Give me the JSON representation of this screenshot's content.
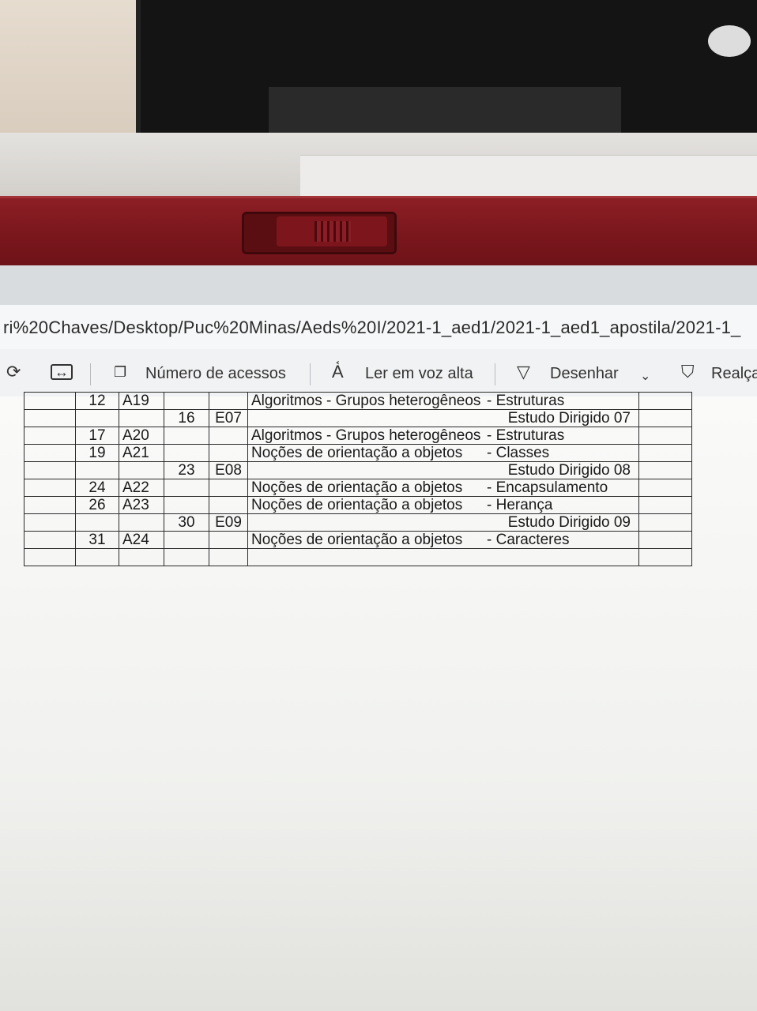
{
  "address_bar": {
    "url_text": "ri%20Chaves/Desktop/Puc%20Minas/Aeds%20I/2021-1_aed1/2021-1_aed1_apostila/2021-1_"
  },
  "toolbar": {
    "items": [
      {
        "name": "rotate",
        "icon": "rotate-icon"
      },
      {
        "name": "fit",
        "icon": "fit-width-icon"
      },
      {
        "name": "page_view",
        "label": "Número de acessos",
        "icon": "page-view-icon"
      },
      {
        "name": "read_aloud",
        "label": "Ler em voz alta",
        "icon": "read-aloud-icon"
      },
      {
        "name": "draw",
        "label": "Desenhar",
        "icon": "draw-icon"
      },
      {
        "name": "highlight",
        "label": "Realça",
        "icon": "highlight-icon"
      }
    ]
  },
  "table": {
    "rows": [
      {
        "day": "12",
        "code": "A19",
        "day2": "",
        "code2": "",
        "topic": "Algoritmos - Grupos heterogêneos",
        "sub": "- Estruturas",
        "study": ""
      },
      {
        "day": "",
        "code": "",
        "day2": "16",
        "code2": "E07",
        "topic": "",
        "sub": "",
        "study": "Estudo Dirigido 07"
      },
      {
        "day": "17",
        "code": "A20",
        "day2": "",
        "code2": "",
        "topic": "Algoritmos - Grupos heterogêneos",
        "sub": "- Estruturas",
        "study": ""
      },
      {
        "day": "19",
        "code": "A21",
        "day2": "",
        "code2": "",
        "topic": "Noções de orientação a objetos",
        "sub": "- Classes",
        "study": ""
      },
      {
        "day": "",
        "code": "",
        "day2": "23",
        "code2": "E08",
        "topic": "",
        "sub": "",
        "study": "Estudo Dirigido 08"
      },
      {
        "day": "24",
        "code": "A22",
        "day2": "",
        "code2": "",
        "topic": "Noções de orientação a objetos",
        "sub": "- Encapsulamento",
        "study": ""
      },
      {
        "day": "26",
        "code": "A23",
        "day2": "",
        "code2": "",
        "topic": "Noções de orientação a objetos",
        "sub": "- Herança",
        "study": ""
      },
      {
        "day": "",
        "code": "",
        "day2": "30",
        "code2": "E09",
        "topic": "",
        "sub": "",
        "study": "Estudo Dirigido 09"
      },
      {
        "day": "31",
        "code": "A24",
        "day2": "",
        "code2": "",
        "topic": "Noções de orientação a objetos",
        "sub": "- Caracteres",
        "study": ""
      },
      {
        "day": "",
        "code": "",
        "day2": "",
        "code2": "",
        "topic": "",
        "sub": "",
        "study": ""
      }
    ]
  }
}
